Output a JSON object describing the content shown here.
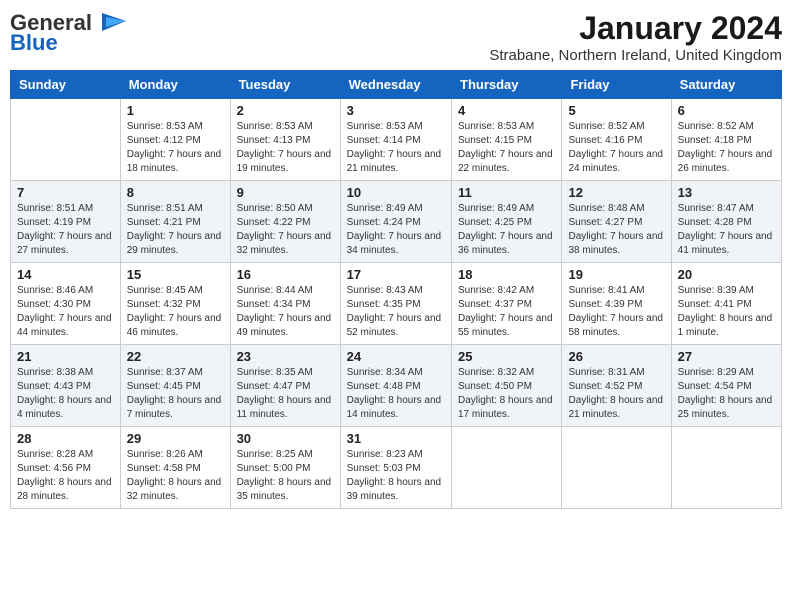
{
  "header": {
    "logo_general": "General",
    "logo_blue": "Blue",
    "title": "January 2024",
    "subtitle": "Strabane, Northern Ireland, United Kingdom"
  },
  "columns": [
    "Sunday",
    "Monday",
    "Tuesday",
    "Wednesday",
    "Thursday",
    "Friday",
    "Saturday"
  ],
  "weeks": [
    [
      {
        "day": "",
        "sunrise": "",
        "sunset": "",
        "daylight": ""
      },
      {
        "day": "1",
        "sunrise": "Sunrise: 8:53 AM",
        "sunset": "Sunset: 4:12 PM",
        "daylight": "Daylight: 7 hours and 18 minutes."
      },
      {
        "day": "2",
        "sunrise": "Sunrise: 8:53 AM",
        "sunset": "Sunset: 4:13 PM",
        "daylight": "Daylight: 7 hours and 19 minutes."
      },
      {
        "day": "3",
        "sunrise": "Sunrise: 8:53 AM",
        "sunset": "Sunset: 4:14 PM",
        "daylight": "Daylight: 7 hours and 21 minutes."
      },
      {
        "day": "4",
        "sunrise": "Sunrise: 8:53 AM",
        "sunset": "Sunset: 4:15 PM",
        "daylight": "Daylight: 7 hours and 22 minutes."
      },
      {
        "day": "5",
        "sunrise": "Sunrise: 8:52 AM",
        "sunset": "Sunset: 4:16 PM",
        "daylight": "Daylight: 7 hours and 24 minutes."
      },
      {
        "day": "6",
        "sunrise": "Sunrise: 8:52 AM",
        "sunset": "Sunset: 4:18 PM",
        "daylight": "Daylight: 7 hours and 26 minutes."
      }
    ],
    [
      {
        "day": "7",
        "sunrise": "Sunrise: 8:51 AM",
        "sunset": "Sunset: 4:19 PM",
        "daylight": "Daylight: 7 hours and 27 minutes."
      },
      {
        "day": "8",
        "sunrise": "Sunrise: 8:51 AM",
        "sunset": "Sunset: 4:21 PM",
        "daylight": "Daylight: 7 hours and 29 minutes."
      },
      {
        "day": "9",
        "sunrise": "Sunrise: 8:50 AM",
        "sunset": "Sunset: 4:22 PM",
        "daylight": "Daylight: 7 hours and 32 minutes."
      },
      {
        "day": "10",
        "sunrise": "Sunrise: 8:49 AM",
        "sunset": "Sunset: 4:24 PM",
        "daylight": "Daylight: 7 hours and 34 minutes."
      },
      {
        "day": "11",
        "sunrise": "Sunrise: 8:49 AM",
        "sunset": "Sunset: 4:25 PM",
        "daylight": "Daylight: 7 hours and 36 minutes."
      },
      {
        "day": "12",
        "sunrise": "Sunrise: 8:48 AM",
        "sunset": "Sunset: 4:27 PM",
        "daylight": "Daylight: 7 hours and 38 minutes."
      },
      {
        "day": "13",
        "sunrise": "Sunrise: 8:47 AM",
        "sunset": "Sunset: 4:28 PM",
        "daylight": "Daylight: 7 hours and 41 minutes."
      }
    ],
    [
      {
        "day": "14",
        "sunrise": "Sunrise: 8:46 AM",
        "sunset": "Sunset: 4:30 PM",
        "daylight": "Daylight: 7 hours and 44 minutes."
      },
      {
        "day": "15",
        "sunrise": "Sunrise: 8:45 AM",
        "sunset": "Sunset: 4:32 PM",
        "daylight": "Daylight: 7 hours and 46 minutes."
      },
      {
        "day": "16",
        "sunrise": "Sunrise: 8:44 AM",
        "sunset": "Sunset: 4:34 PM",
        "daylight": "Daylight: 7 hours and 49 minutes."
      },
      {
        "day": "17",
        "sunrise": "Sunrise: 8:43 AM",
        "sunset": "Sunset: 4:35 PM",
        "daylight": "Daylight: 7 hours and 52 minutes."
      },
      {
        "day": "18",
        "sunrise": "Sunrise: 8:42 AM",
        "sunset": "Sunset: 4:37 PM",
        "daylight": "Daylight: 7 hours and 55 minutes."
      },
      {
        "day": "19",
        "sunrise": "Sunrise: 8:41 AM",
        "sunset": "Sunset: 4:39 PM",
        "daylight": "Daylight: 7 hours and 58 minutes."
      },
      {
        "day": "20",
        "sunrise": "Sunrise: 8:39 AM",
        "sunset": "Sunset: 4:41 PM",
        "daylight": "Daylight: 8 hours and 1 minute."
      }
    ],
    [
      {
        "day": "21",
        "sunrise": "Sunrise: 8:38 AM",
        "sunset": "Sunset: 4:43 PM",
        "daylight": "Daylight: 8 hours and 4 minutes."
      },
      {
        "day": "22",
        "sunrise": "Sunrise: 8:37 AM",
        "sunset": "Sunset: 4:45 PM",
        "daylight": "Daylight: 8 hours and 7 minutes."
      },
      {
        "day": "23",
        "sunrise": "Sunrise: 8:35 AM",
        "sunset": "Sunset: 4:47 PM",
        "daylight": "Daylight: 8 hours and 11 minutes."
      },
      {
        "day": "24",
        "sunrise": "Sunrise: 8:34 AM",
        "sunset": "Sunset: 4:48 PM",
        "daylight": "Daylight: 8 hours and 14 minutes."
      },
      {
        "day": "25",
        "sunrise": "Sunrise: 8:32 AM",
        "sunset": "Sunset: 4:50 PM",
        "daylight": "Daylight: 8 hours and 17 minutes."
      },
      {
        "day": "26",
        "sunrise": "Sunrise: 8:31 AM",
        "sunset": "Sunset: 4:52 PM",
        "daylight": "Daylight: 8 hours and 21 minutes."
      },
      {
        "day": "27",
        "sunrise": "Sunrise: 8:29 AM",
        "sunset": "Sunset: 4:54 PM",
        "daylight": "Daylight: 8 hours and 25 minutes."
      }
    ],
    [
      {
        "day": "28",
        "sunrise": "Sunrise: 8:28 AM",
        "sunset": "Sunset: 4:56 PM",
        "daylight": "Daylight: 8 hours and 28 minutes."
      },
      {
        "day": "29",
        "sunrise": "Sunrise: 8:26 AM",
        "sunset": "Sunset: 4:58 PM",
        "daylight": "Daylight: 8 hours and 32 minutes."
      },
      {
        "day": "30",
        "sunrise": "Sunrise: 8:25 AM",
        "sunset": "Sunset: 5:00 PM",
        "daylight": "Daylight: 8 hours and 35 minutes."
      },
      {
        "day": "31",
        "sunrise": "Sunrise: 8:23 AM",
        "sunset": "Sunset: 5:03 PM",
        "daylight": "Daylight: 8 hours and 39 minutes."
      },
      {
        "day": "",
        "sunrise": "",
        "sunset": "",
        "daylight": ""
      },
      {
        "day": "",
        "sunrise": "",
        "sunset": "",
        "daylight": ""
      },
      {
        "day": "",
        "sunrise": "",
        "sunset": "",
        "daylight": ""
      }
    ]
  ]
}
